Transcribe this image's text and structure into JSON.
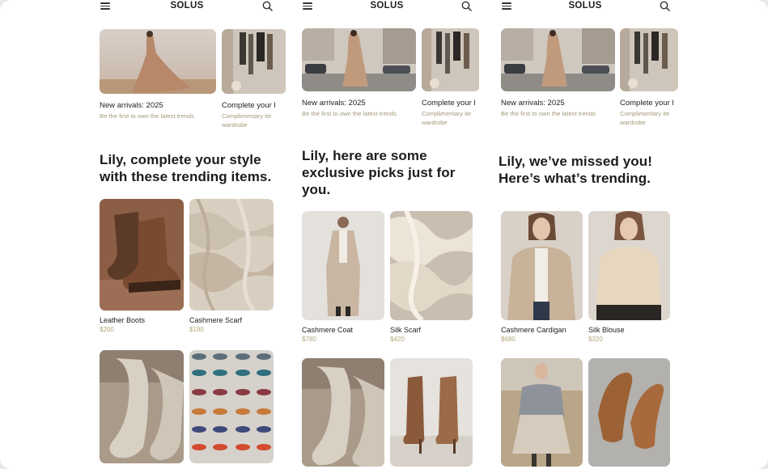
{
  "screens": [
    {
      "brand": "SOLUS",
      "banners": [
        {
          "title": "New arrivals: 2025",
          "subtitle": "Be the first to own the latest trends",
          "subtitle2": ""
        },
        {
          "title": "Complete your l",
          "subtitle": "Complimentary ite",
          "subtitle2": "wardrobe"
        }
      ],
      "headline_lines": [
        "Lily, complete your style",
        "with these trending items."
      ],
      "products": [
        {
          "name": "Leather Boots",
          "price": "$200"
        },
        {
          "name": "Cashmere Scarf",
          "price": "$180"
        },
        {
          "name": "",
          "price": ""
        },
        {
          "name": "",
          "price": ""
        }
      ]
    },
    {
      "brand": "SOLUS",
      "banners": [
        {
          "title": "New arrivals: 2025",
          "subtitle": "Be the first to own the latest trends",
          "subtitle2": ""
        },
        {
          "title": "Complete your l",
          "subtitle": "Complimentary ite",
          "subtitle2": "wardrobe"
        }
      ],
      "headline_lines": [
        "Lily, here are some",
        "exclusive picks just for",
        "you."
      ],
      "products": [
        {
          "name": "Cashmere Coat",
          "price": "$780"
        },
        {
          "name": "Silk Scarf",
          "price": "$420"
        },
        {
          "name": "",
          "price": ""
        },
        {
          "name": "",
          "price": ""
        }
      ]
    },
    {
      "brand": "SOLUS",
      "banners": [
        {
          "title": "New arrivals: 2025",
          "subtitle": "Be the first to own the latest trends",
          "subtitle2": ""
        },
        {
          "title": "Complete your l",
          "subtitle": "Complimentary ite",
          "subtitle2": "wardrobe"
        }
      ],
      "headline_lines": [
        "Lily, we’ve missed you!",
        "Here’s what’s trending."
      ],
      "products": [
        {
          "name": "Cashmere Cardigan",
          "price": "$680"
        },
        {
          "name": "Silk Blouse",
          "price": "$320"
        },
        {
          "name": "",
          "price": ""
        },
        {
          "name": "",
          "price": ""
        }
      ]
    }
  ],
  "colors": {
    "price": "#b3a87c",
    "subtitle": "#a39a78",
    "text": "#1d1d1d"
  }
}
